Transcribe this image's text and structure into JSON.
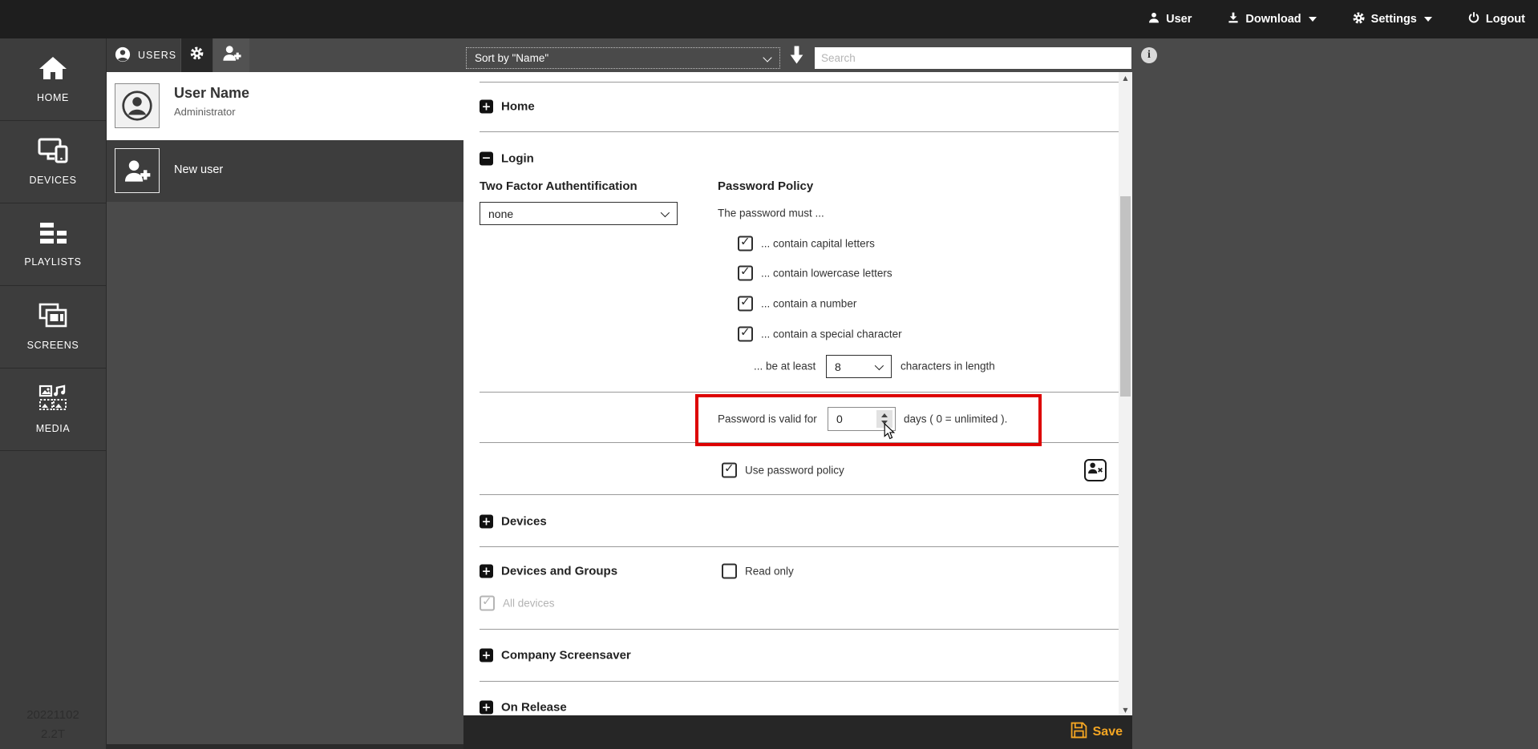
{
  "topbar": {
    "items": [
      {
        "label": "User",
        "icon": "user-icon",
        "caret": false
      },
      {
        "label": "Download",
        "icon": "download-icon",
        "caret": true
      },
      {
        "label": "Settings",
        "icon": "gear-icon",
        "caret": true
      },
      {
        "label": "Logout",
        "icon": "power-icon",
        "caret": false
      }
    ]
  },
  "sidebar": {
    "items": [
      {
        "label": "HOME",
        "icon": "home-icon"
      },
      {
        "label": "DEVICES",
        "icon": "devices-icon"
      },
      {
        "label": "PLAYLISTS",
        "icon": "playlists-icon"
      },
      {
        "label": "SCREENS",
        "icon": "screens-icon"
      },
      {
        "label": "MEDIA",
        "icon": "media-icon"
      }
    ],
    "version": {
      "line1": "20221102",
      "line2": "2.2T"
    }
  },
  "toolbar": {
    "users_tab": "USERS",
    "sort_value": "Sort by \"Name\"",
    "search_placeholder": "Search"
  },
  "user_list": {
    "selected_user": {
      "name": "User Name",
      "role": "Administrator"
    },
    "new_user_label": "New user"
  },
  "content": {
    "sections": {
      "home": "Home",
      "login": "Login",
      "devices": "Devices",
      "devices_groups": "Devices and Groups",
      "screensaver": "Company Screensaver",
      "release": "On Release"
    },
    "login": {
      "tfa_label": "Two Factor Authentification",
      "tfa_value": "none",
      "policy_title": "Password Policy",
      "policy_intro": "The password must ...",
      "policy_checks": [
        "... contain capital letters",
        "... contain lowercase letters",
        "... contain a number",
        "... contain a special character"
      ],
      "length_prefix": "... be at least",
      "length_value": "8",
      "length_suffix": "characters in length",
      "valid_label": "Password is valid for",
      "valid_value": "0",
      "valid_suffix": "days ( 0 = unlimited ).",
      "use_policy_label": "Use password policy"
    },
    "devices_groups": {
      "read_only": "Read only",
      "all_devices": "All devices"
    }
  },
  "footer": {
    "save_label": "Save"
  },
  "colors": {
    "accent_orange": "#f5a623",
    "highlight_red": "#dd0000"
  }
}
